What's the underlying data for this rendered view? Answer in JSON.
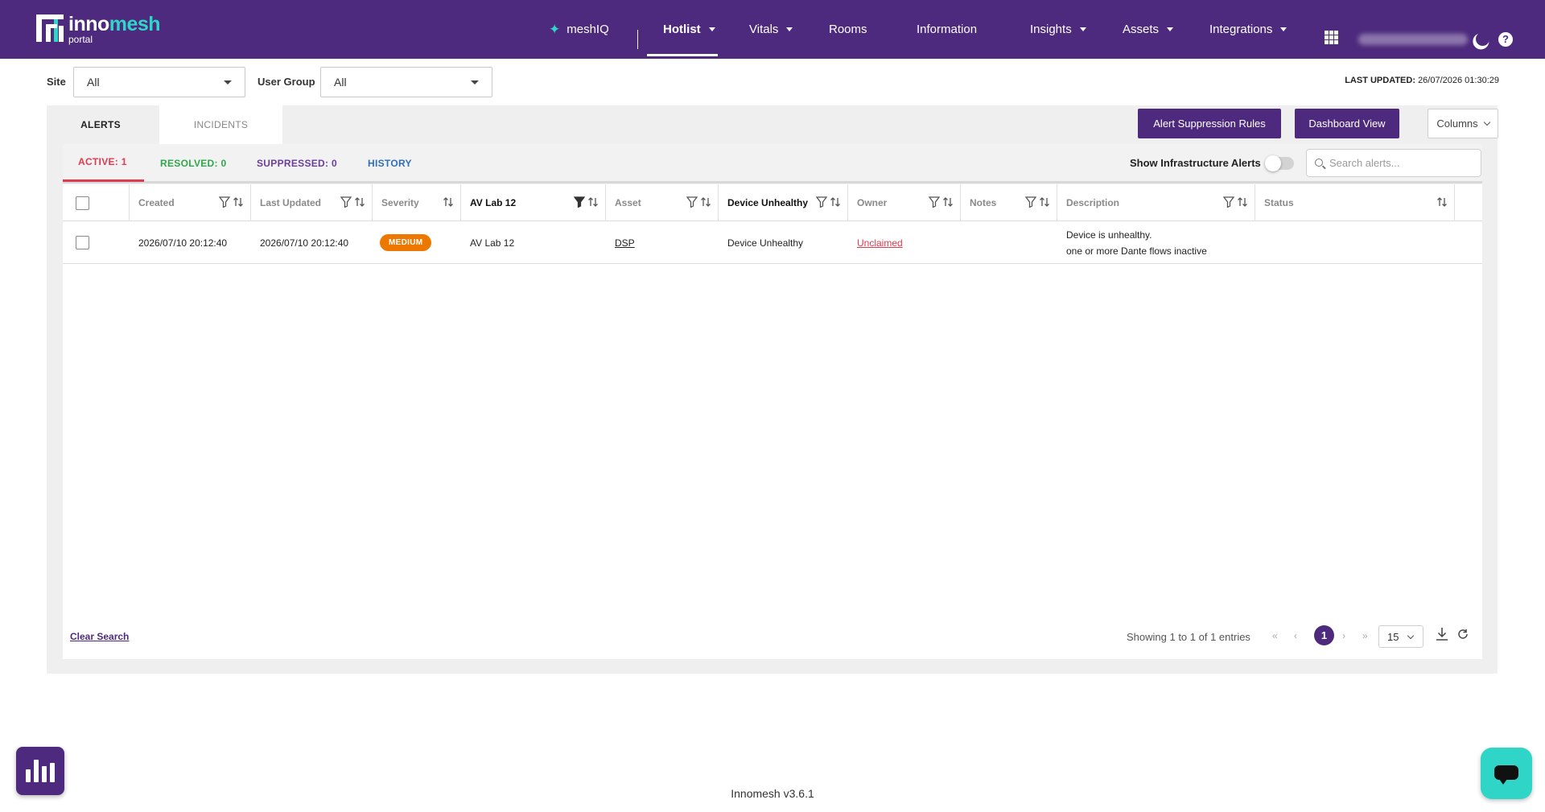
{
  "brand": {
    "name_part1": "inno",
    "name_part2": "mesh",
    "subtitle": "portal"
  },
  "nav": {
    "meshiq": "meshIQ",
    "items": [
      {
        "label": "Hotlist",
        "active": true,
        "dropdown": true
      },
      {
        "label": "Vitals",
        "dropdown": true
      },
      {
        "label": "Rooms"
      },
      {
        "label": "Information"
      },
      {
        "label": "Insights",
        "dropdown": true
      },
      {
        "label": "Assets",
        "dropdown": true
      },
      {
        "label": "Integrations",
        "dropdown": true
      }
    ],
    "icons": [
      "apps-grid-icon",
      "user-name-blurred",
      "dark-mode-moon-icon",
      "help-icon"
    ],
    "help_symbol": "?"
  },
  "filters": {
    "site_label": "Site",
    "site_value": "All",
    "user_group_label": "User Group",
    "user_group_value": "All"
  },
  "last_updated": {
    "label": "LAST UPDATED:",
    "value": "26/07/2026 01:30:29"
  },
  "tabs": {
    "alerts": "ALERTS",
    "incidents": "INCIDENTS"
  },
  "actions": {
    "suppression": "Alert Suppression Rules",
    "dashboard": "Dashboard View",
    "columns": "Columns"
  },
  "subtabs": {
    "active": "ACTIVE: 1",
    "resolved": "RESOLVED: 0",
    "suppressed": "SUPPRESSED: 0",
    "history": "HISTORY"
  },
  "infra_toggle": {
    "label": "Show Infrastructure Alerts",
    "on": false
  },
  "search": {
    "placeholder": "Search alerts..."
  },
  "table": {
    "columns": [
      "Created",
      "Last Updated",
      "Severity",
      "AV Lab 12",
      "Asset",
      "Device Unhealthy",
      "Owner",
      "Notes",
      "Description",
      "Status"
    ],
    "rows": [
      {
        "created": "2026/07/10 20:12:40",
        "last_updated": "2026/07/10 20:12:40",
        "severity": "MEDIUM",
        "room": "AV Lab 12",
        "asset": "DSP",
        "type": "Device Unhealthy",
        "owner": "Unclaimed",
        "notes": "",
        "description_line1": "Device is unhealthy.",
        "description_line2": "one or more Dante flows inactive",
        "status": ""
      }
    ]
  },
  "pagination": {
    "clear_search": "Clear Search",
    "showing": "Showing 1 to 1 of 1 entries",
    "first": "«",
    "prev": "‹",
    "current_page": "1",
    "next": "›",
    "last": "»",
    "per_page": "15"
  },
  "colors": {
    "brand_purple": "#4e2a7e",
    "accent_teal": "#2fd6c7",
    "active_red": "#e03a4e",
    "resolved_green": "#2ea84a",
    "suppressed_purple": "#6b3d9a",
    "history_blue": "#2f6fb3",
    "severity_medium": "#ee7700"
  },
  "version": "Innomesh v3.6.1"
}
